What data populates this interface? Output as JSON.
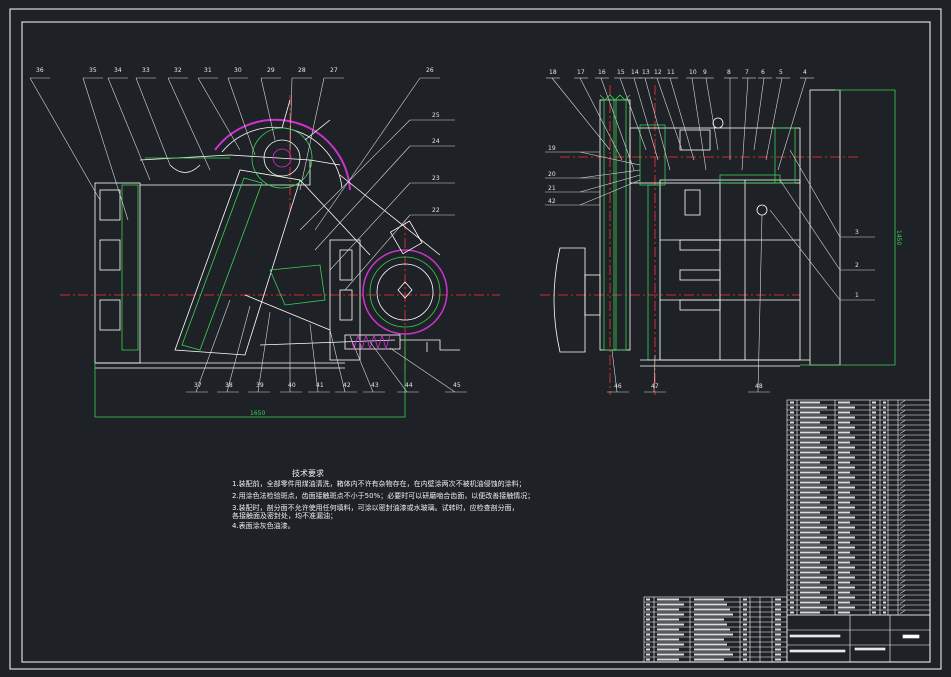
{
  "left_labels_top": [
    "36",
    "35",
    "34",
    "33",
    "32",
    "31",
    "30",
    "29",
    "28",
    "27",
    "26"
  ],
  "left_labels_right": [
    "25",
    "24",
    "23",
    "22"
  ],
  "left_labels_bottom": [
    "37",
    "38",
    "39",
    "40",
    "41",
    "42",
    "43",
    "44",
    "45"
  ],
  "right_labels_top": [
    "18",
    "17",
    "16",
    "15",
    "14",
    "13",
    "12",
    "11",
    "10",
    "9",
    "8",
    "7",
    "6",
    "5",
    "4"
  ],
  "right_labels_left": [
    "19",
    "20",
    "21",
    "42"
  ],
  "right_labels_right": [
    "3",
    "2",
    "1"
  ],
  "right_labels_bottom": [
    "46",
    "47",
    "48"
  ],
  "dims": {
    "overall_width": "1650",
    "height_dim": "1450"
  },
  "notes": {
    "title": "技术要求",
    "lines": [
      "1.装配前，全部零件用煤油清洗，箱体内不许有杂物存在，在内壁涂两次不被机油侵蚀的涂料；",
      "2.用涂色法检验斑点，齿面接触斑点不小于50%；必要时可以研磨啮合齿面，以便改善接触情况；",
      "3.装配时，剖分面不允许使用任何填料，可涂以密封油漆或水玻璃。试转时，应检查剖分面，",
      "  各接触面及密封处，均不准漏油；",
      "4.表面涂灰色油漆。"
    ]
  },
  "colors": {
    "bg": "#1e2126",
    "line": "#ffffff",
    "hatch": "#39d353",
    "center": "#ff3333",
    "accent": "#cc33cc",
    "leader": "#d8d8d8"
  }
}
